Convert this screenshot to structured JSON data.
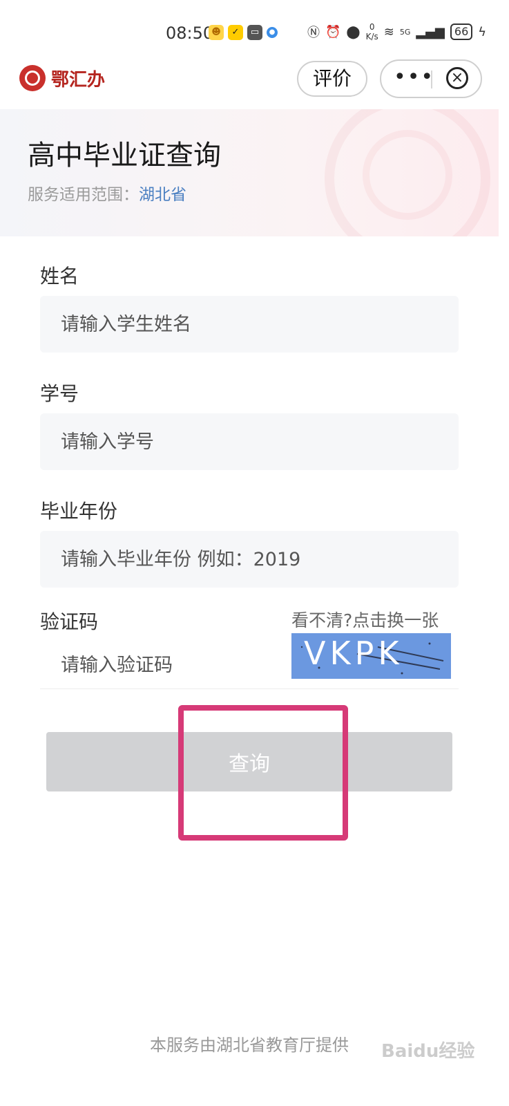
{
  "status_bar": {
    "time": "08:50",
    "net_speed_value": "0",
    "net_speed_unit": "K/s",
    "signal": "5G",
    "battery": "66"
  },
  "nav": {
    "app_name": "鄂汇办",
    "rate_label": "评价",
    "more_label": "•••",
    "close_label": "×"
  },
  "header": {
    "title": "高中毕业证查询",
    "scope_label": "服务适用范围：",
    "scope_value": "湖北省"
  },
  "form": {
    "name": {
      "label": "姓名",
      "placeholder": "请输入学生姓名"
    },
    "student_id": {
      "label": "学号",
      "placeholder": "请输入学号"
    },
    "grad_year": {
      "label": "毕业年份",
      "placeholder": "请输入毕业年份 例如：2019"
    },
    "captcha": {
      "label": "验证码",
      "placeholder": "请输入验证码",
      "refresh_label": "看不清?点击换一张",
      "code": "VKPK"
    },
    "submit_label": "查询"
  },
  "footer": {
    "text": "本服务由湖北省教育厅提供"
  },
  "watermark": "Baidu经验",
  "colors": {
    "brand_red": "#b5251f",
    "scope_blue": "#4a7fc1",
    "button_disabled": "#d1d2d4",
    "highlight": "#d63a77",
    "captcha_bg": "#6b98e0"
  }
}
